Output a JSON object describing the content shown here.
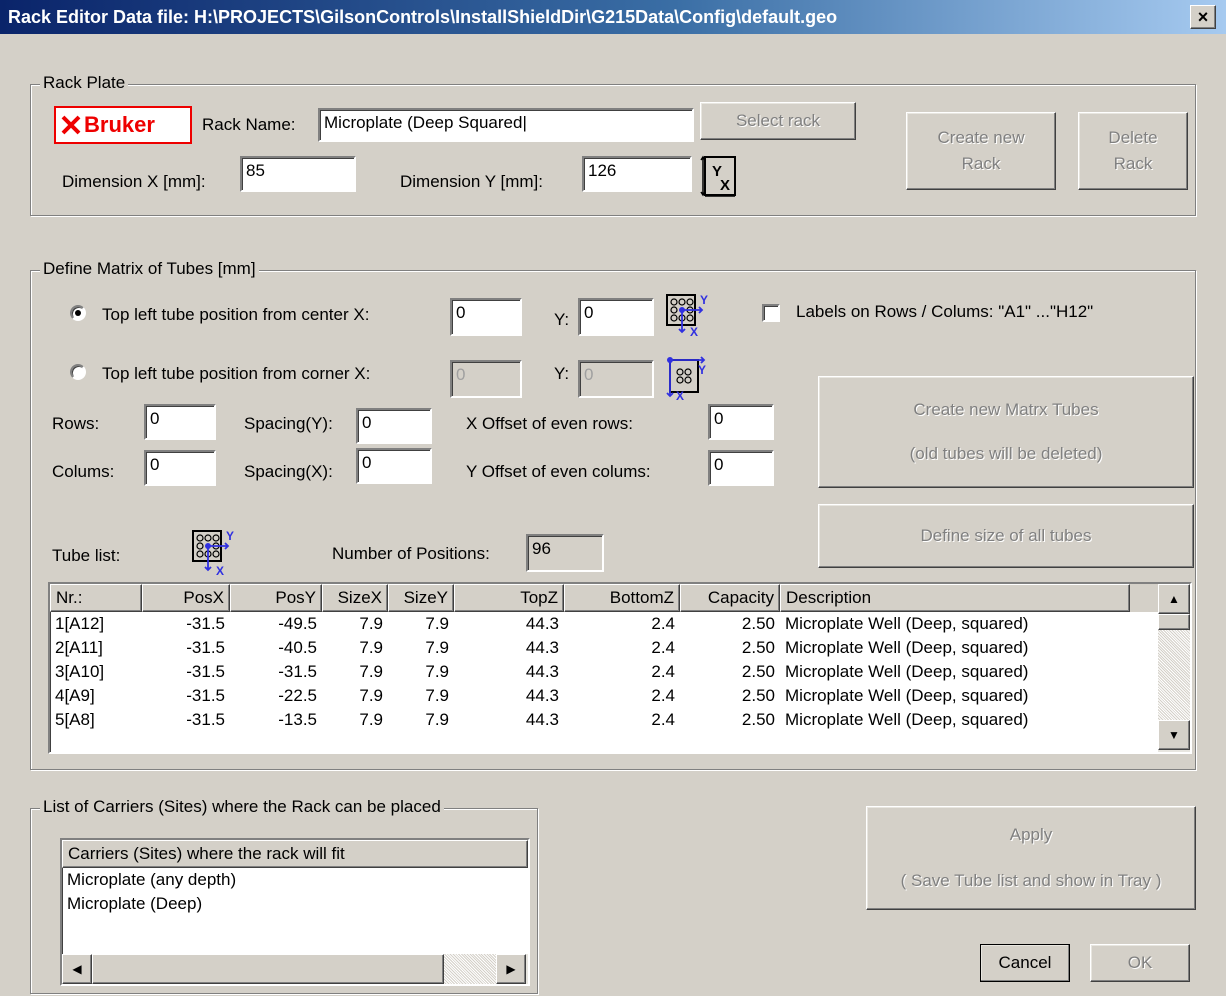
{
  "window": {
    "title": "Rack Editor  Data file: H:\\PROJECTS\\GilsonControls\\InstallShieldDir\\G215Data\\Config\\default.geo",
    "close_label": "×"
  },
  "rack_plate": {
    "legend": "Rack Plate",
    "logo_text": "Bruker",
    "rack_name_label": "Rack Name:",
    "rack_name_value": "Microplate (Deep Squared|",
    "select_rack_label": "Select rack",
    "create_new_rack_line1": "Create new",
    "create_new_rack_line2": "Rack",
    "delete_rack_line1": "Delete",
    "delete_rack_line2": "Rack",
    "dim_x_label": "Dimension X [mm]:",
    "dim_x_value": "85",
    "dim_y_label": "Dimension Y [mm]:",
    "dim_y_value": "126"
  },
  "matrix": {
    "legend": "Define Matrix of Tubes [mm]",
    "center_label": "Top left tube position from center X:",
    "center_x": "0",
    "center_y_label": "Y:",
    "center_y": "0",
    "corner_label": "Top left tube position from corner X:",
    "corner_x": "0",
    "corner_y_label": "Y:",
    "corner_y": "0",
    "labels_checkbox": "Labels on Rows / Colums: \"A1\" ...\"H12\"",
    "rows_label": "Rows:",
    "rows_value": "0",
    "colums_label": "Colums:",
    "colums_value": "0",
    "spacing_y_label": "Spacing(Y):",
    "spacing_y_value": "0",
    "spacing_x_label": "Spacing(X):",
    "spacing_x_value": "0",
    "x_offset_label": "X Offset of even rows:",
    "x_offset_value": "0",
    "y_offset_label": "Y Offset of even colums:",
    "y_offset_value": "0",
    "create_matrix_line1": "Create new Matrx Tubes",
    "create_matrix_line2": "(old tubes will be deleted)",
    "define_size_label": "Define size of all tubes",
    "tube_list_label": "Tube list:",
    "num_positions_label": "Number of Positions:",
    "num_positions_value": "96"
  },
  "tube_table": {
    "columns": [
      "Nr.:",
      "PosX",
      "PosY",
      "SizeX",
      "SizeY",
      "TopZ",
      "BottomZ",
      "Capacity",
      "Description"
    ],
    "rows": [
      [
        "1[A12]",
        "-31.5",
        "-49.5",
        "7.9",
        "7.9",
        "44.3",
        "2.4",
        "2.50",
        "Microplate Well (Deep, squared)"
      ],
      [
        "2[A11]",
        "-31.5",
        "-40.5",
        "7.9",
        "7.9",
        "44.3",
        "2.4",
        "2.50",
        "Microplate Well (Deep, squared)"
      ],
      [
        "3[A10]",
        "-31.5",
        "-31.5",
        "7.9",
        "7.9",
        "44.3",
        "2.4",
        "2.50",
        "Microplate Well (Deep, squared)"
      ],
      [
        "4[A9]",
        "-31.5",
        "-22.5",
        "7.9",
        "7.9",
        "44.3",
        "2.4",
        "2.50",
        "Microplate Well (Deep, squared)"
      ],
      [
        "5[A8]",
        "-31.5",
        "-13.5",
        "7.9",
        "7.9",
        "44.3",
        "2.4",
        "2.50",
        "Microplate Well (Deep, squared)"
      ]
    ]
  },
  "carriers": {
    "legend": "List of Carriers (Sites) where the Rack can be placed",
    "header": "Carriers (Sites) where the rack will fit",
    "items": [
      "Microplate (any depth)",
      "Microplate (Deep)"
    ]
  },
  "footer": {
    "apply_line1": "Apply",
    "apply_line2": "( Save Tube list and show in Tray )",
    "cancel_label": "Cancel",
    "ok_label": "OK"
  }
}
